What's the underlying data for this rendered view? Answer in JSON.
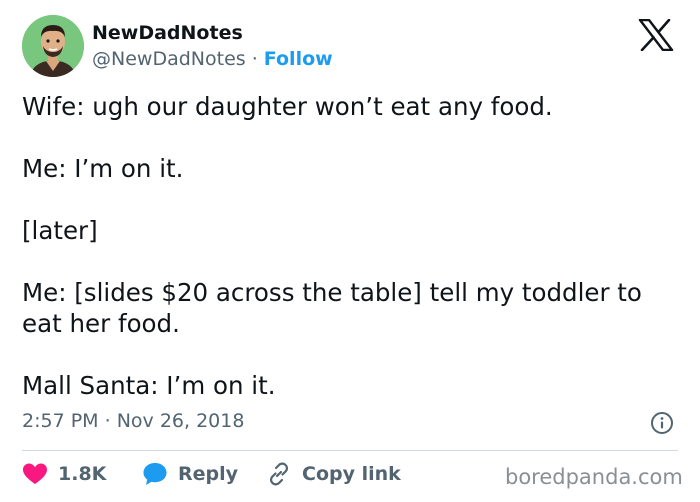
{
  "author": {
    "name": "NewDadNotes",
    "handle": "@NewDadNotes",
    "separator": "·",
    "follow_label": "Follow"
  },
  "tweet": {
    "lines": [
      "Wife: ugh our daughter won’t eat any food.",
      "Me: I’m on it.",
      "[later]",
      "Me: [slides $20 across the table] tell my toddler to eat her food.",
      "Mall Santa: I’m on it."
    ]
  },
  "meta": {
    "time": "2:57 PM",
    "separator": "·",
    "date": "Nov 26, 2018"
  },
  "actions": {
    "likes_count": "1.8K",
    "reply_label": "Reply",
    "copy_link_label": "Copy link"
  },
  "icons": {
    "logo": "x-logo-icon",
    "info": "info-icon",
    "like": "heart-icon",
    "reply": "speech-bubble-icon",
    "copy": "link-icon"
  },
  "watermark": "boredpanda.com",
  "colors": {
    "text": "#0f1419",
    "secondary": "#536471",
    "link": "#1d9bf0",
    "like": "#f91880",
    "reply": "#1d9bf0",
    "avatar_bg": "#79c77f",
    "divider": "#cfd9de"
  }
}
